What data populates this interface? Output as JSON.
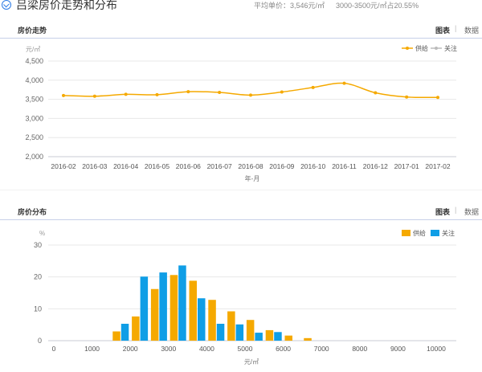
{
  "header": {
    "title": "吕梁房价走势和分布",
    "avg_price": "平均单价：3,546元/㎡",
    "range_share": "3000-3500元/㎡占20.55%"
  },
  "trend": {
    "title": "房价走势",
    "tab_chart": "图表",
    "tab_sep": "|",
    "tab_data": "数据"
  },
  "dist": {
    "title": "房价分布",
    "tab_chart": "图表",
    "tab_sep": "|",
    "tab_data": "数据"
  },
  "colors": {
    "supply": "#f5a900",
    "follow": "#bbbbbb",
    "follow_bar": "#0f9ee6",
    "grid": "#e8e8e8",
    "axis": "#c9cbd6"
  },
  "chart_data": [
    {
      "type": "line",
      "unit": "元/㎡",
      "xlabel": "年-月",
      "categories": [
        "2016-02",
        "2016-03",
        "2016-04",
        "2016-05",
        "2016-06",
        "2016-07",
        "2016-08",
        "2016-09",
        "2016-10",
        "2016-11",
        "2016-12",
        "2017-01",
        "2017-02"
      ],
      "yticks": [
        2000,
        2500,
        3000,
        3500,
        4000,
        4500
      ],
      "ytick_labels": [
        "2,000",
        "2,500",
        "3,000",
        "3,500",
        "4,000",
        "4,500"
      ],
      "ylim": [
        2000,
        4500
      ],
      "series": [
        {
          "name": "供给",
          "values": [
            3600,
            3580,
            3630,
            3620,
            3700,
            3680,
            3610,
            3690,
            3810,
            3920,
            3670,
            3560,
            3550
          ]
        },
        {
          "name": "关注",
          "values": []
        }
      ],
      "legend": "top-right",
      "grid": true
    },
    {
      "type": "bar",
      "unit": "%",
      "xlabel": "元/㎡",
      "xticks": [
        0,
        1000,
        2000,
        3000,
        4000,
        5000,
        6000,
        7000,
        8000,
        9000,
        10000
      ],
      "yticks": [
        0,
        10,
        20,
        30
      ],
      "ylim": [
        0,
        30
      ],
      "bin_centers": [
        1750,
        2250,
        2750,
        3250,
        3750,
        4250,
        4750,
        5250,
        5750,
        6250,
        6750
      ],
      "series": [
        {
          "name": "供给",
          "values": [
            2.9,
            7.6,
            16.2,
            20.6,
            18.8,
            12.8,
            9.2,
            6.5,
            3.3,
            1.6,
            0.8
          ]
        },
        {
          "name": "关注",
          "values": [
            5.3,
            20.1,
            21.4,
            23.6,
            13.3,
            5.3,
            5.1,
            2.5,
            2.7,
            0,
            0
          ]
        }
      ],
      "legend": "top-right",
      "grid": true
    }
  ]
}
